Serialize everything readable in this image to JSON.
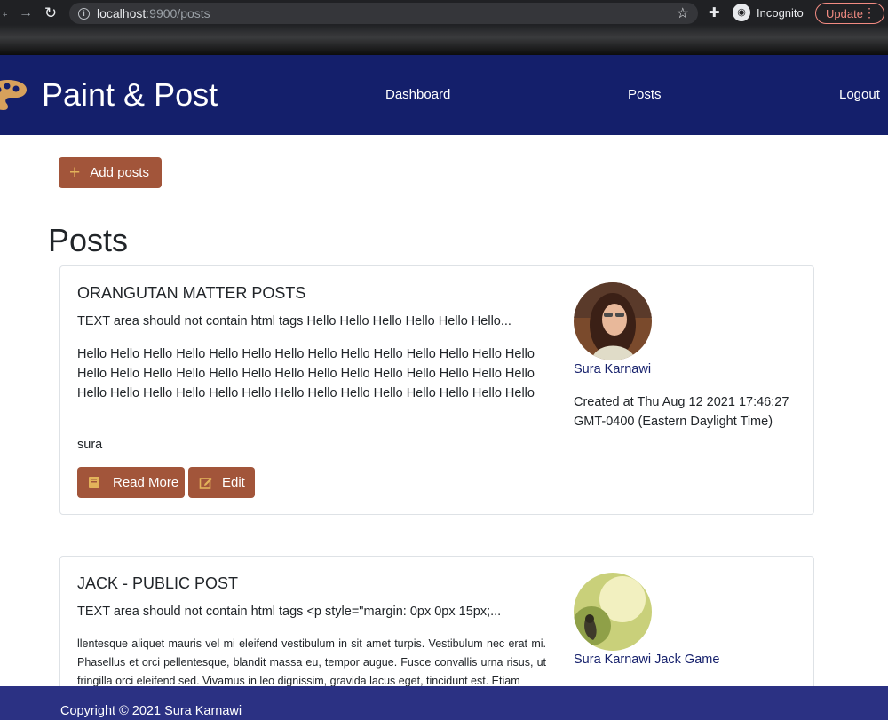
{
  "browser": {
    "url_host": "localhost",
    "url_rest": ":9900/posts",
    "incognito_label": "Incognito",
    "update_label": "Update"
  },
  "header": {
    "brand": "Paint & Post",
    "nav": [
      "Dashboard",
      "Posts",
      "Logout"
    ],
    "bg_color": "#141f6b"
  },
  "main": {
    "add_button": "Add posts",
    "page_title": "Posts",
    "accent_color": "#a2553a"
  },
  "posts": [
    {
      "title": "ORANGUTAN MATTER POSTS",
      "summary": "TEXT area should not contain html tags Hello Hello Hello Hello Hello Hello...",
      "body": "Hello Hello Hello Hello Hello Hello Hello Hello Hello Hello Hello Hello Hello Hello Hello Hello Hello Hello Hello Hello Hello Hello Hello Hello Hello Hello Hello Hello Hello Hello Hello Hello Hello Hello Hello Hello Hello Hello Hello Hello Hello Hello",
      "signature": "sura",
      "author": "Sura Karnawi",
      "created": "Created at Thu Aug 12 2021 17:46:27 GMT-0400 (Eastern Daylight Time)",
      "read_more": "Read More",
      "edit": "Edit"
    },
    {
      "title": "JACK - PUBLIC POST",
      "summary": "TEXT area should not contain html tags <p style=\"margin: 0px 0px 15px;...",
      "body": "llentesque aliquet mauris vel mi eleifend vestibulum in sit amet turpis. Vestibulum nec erat mi. Phasellus et orci pellentesque, blandit massa eu, tempor augue. Fusce convallis urna risus, ut fringilla orci eleifend sed. Vivamus in leo dignissim, gravida lacus eget, tincidunt est. Etiam",
      "author": "Sura Karnawi Jack Game"
    }
  ],
  "footer": {
    "copyright": "Copyright © 2021 Sura Karnawi"
  }
}
